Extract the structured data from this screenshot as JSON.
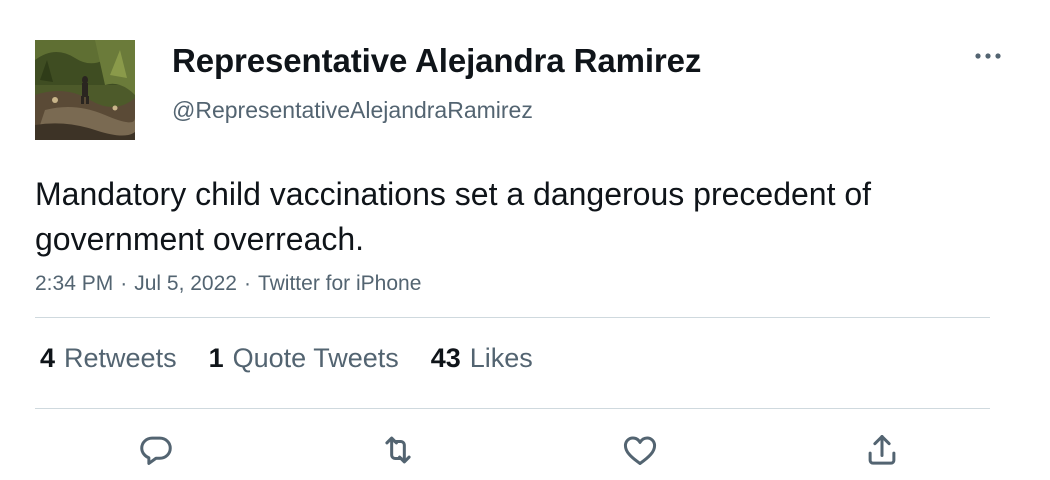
{
  "author": {
    "display_name": "Representative Alejandra Ramirez",
    "handle": "@RepresentativeAlejandraRamirez",
    "avatar_icon": "profile-photo"
  },
  "tweet": {
    "text": "Mandatory child vaccinations set a dangerous precedent of government overreach.",
    "time": "2:34 PM",
    "date": "Jul 5, 2022",
    "source": "Twitter for iPhone",
    "separator": "·"
  },
  "stats": {
    "retweets": {
      "count": "4",
      "label": "Retweets"
    },
    "quote_tweets": {
      "count": "1",
      "label": "Quote Tweets"
    },
    "likes": {
      "count": "43",
      "label": "Likes"
    }
  },
  "actions": [
    {
      "name": "reply",
      "icon": "reply-icon"
    },
    {
      "name": "retweet",
      "icon": "retweet-icon"
    },
    {
      "name": "like",
      "icon": "heart-icon"
    },
    {
      "name": "share",
      "icon": "share-icon"
    }
  ],
  "colors": {
    "text_primary": "#0f1419",
    "text_secondary": "#536471",
    "divider": "#cfd9de"
  }
}
